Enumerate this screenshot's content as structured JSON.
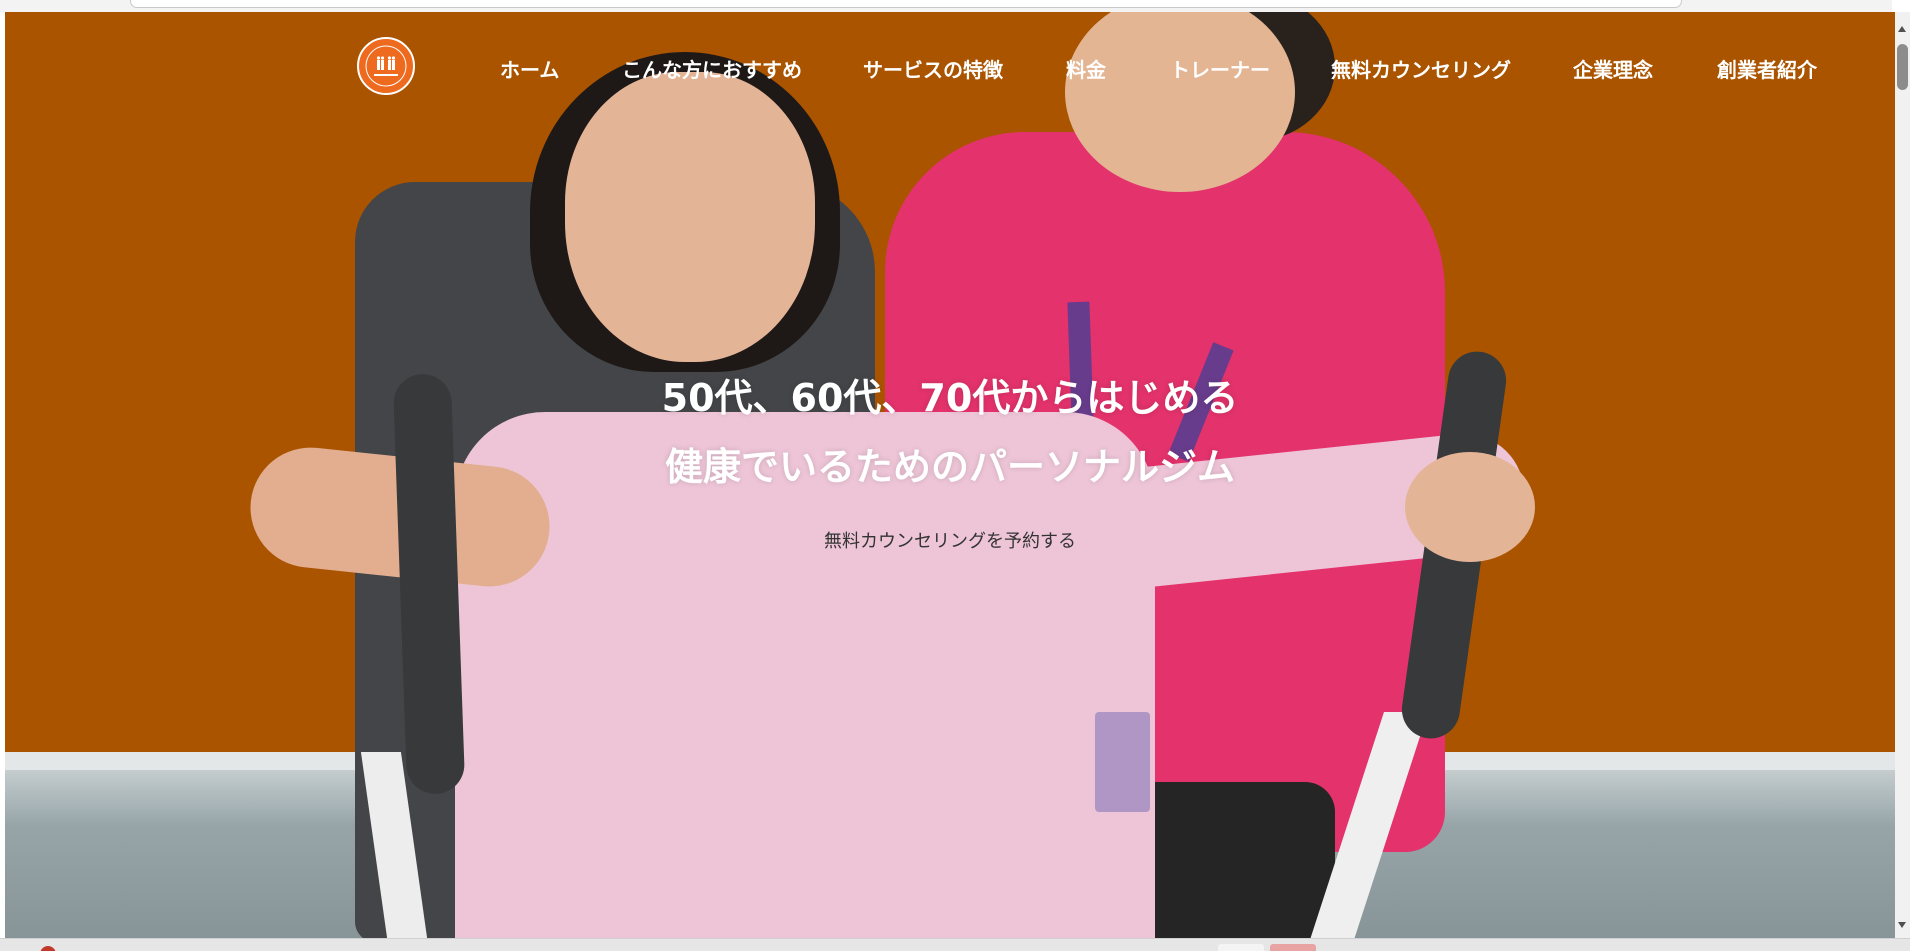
{
  "nav": {
    "logo_alt": "ライフフィットネス",
    "items": [
      {
        "label": "ホーム"
      },
      {
        "label": "こんな方におすすめ"
      },
      {
        "label": "サービスの特徴"
      },
      {
        "label": "料金"
      },
      {
        "label": "トレーナー"
      },
      {
        "label": "無料カウンセリング"
      },
      {
        "label": "企業理念"
      },
      {
        "label": "創業者紹介"
      }
    ]
  },
  "hero": {
    "headline_line1": "50代、60代、70代からはじめる",
    "headline_line2": "健康でいるためのパーソナルジム",
    "cta_label": "無料カウンセリングを予約する",
    "background_color": "#ae5600"
  },
  "colors": {
    "accent": "#ee6a1e",
    "trainer_shirt": "#e8336f",
    "client_shirt": "#f2c9dc"
  }
}
